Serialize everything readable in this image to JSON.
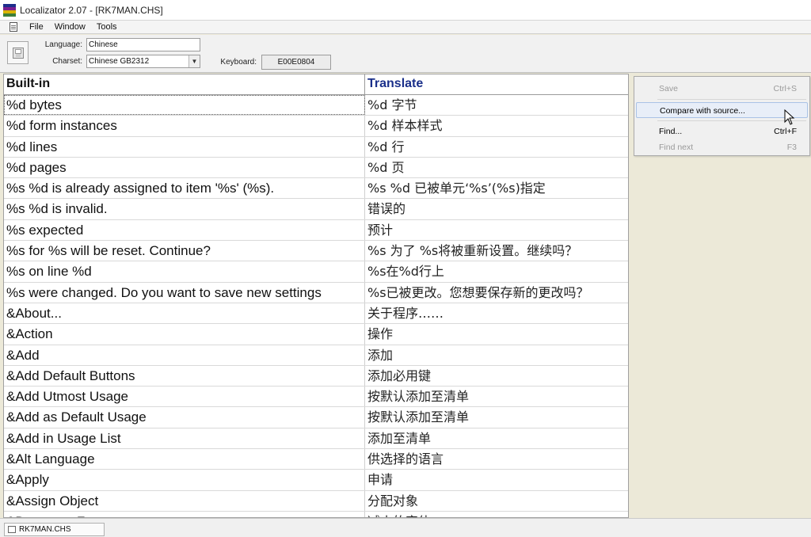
{
  "window": {
    "title": "Localizator 2.07 - [RK7MAN.CHS]"
  },
  "menu": [
    "File",
    "Window",
    "Tools"
  ],
  "toolbar": {
    "language_label": "Language:",
    "language_value": "Chinese",
    "charset_label": "Charset:",
    "charset_value": "Chinese GB2312",
    "keyboard_label": "Keyboard:",
    "keyboard_value": "E00E0804"
  },
  "grid": {
    "columns": [
      "Built-in",
      "Translate"
    ],
    "rows": [
      [
        "%d bytes",
        "%d 字节"
      ],
      [
        "%d form instances",
        "%d 样本样式"
      ],
      [
        "%d lines",
        "%d 行"
      ],
      [
        "%d pages",
        "%d 页"
      ],
      [
        "%s %d is already assigned to item '%s' (%s).",
        "%s %d 已被单元‘%s’(%s)指定"
      ],
      [
        "%s %d is invalid.",
        "错误的"
      ],
      [
        "%s expected",
        "预计"
      ],
      [
        "%s for %s will be reset. Continue?",
        "%s 为了 %s将被重新设置。继续吗？"
      ],
      [
        "%s on line %d",
        "%s在%d行上"
      ],
      [
        "%s were changed. Do you want to save new settings",
        "%s已被更改。您想要保存新的更改吗？"
      ],
      [
        "&About...",
        "关于程序……"
      ],
      [
        "&Action",
        "操作"
      ],
      [
        "&Add",
        "添加"
      ],
      [
        "&Add Default Buttons",
        "添加必用键"
      ],
      [
        "&Add Utmost Usage",
        "按默认添加至清单"
      ],
      [
        "&Add as Default Usage",
        "按默认添加至清单"
      ],
      [
        "&Add in Usage List",
        "添加至清单"
      ],
      [
        "&Alt Language",
        "供选择的语言"
      ],
      [
        "&Apply",
        "申请"
      ],
      [
        "&Assign Object",
        "分配对象"
      ],
      [
        "&Decrease Font",
        "减小的字体"
      ]
    ]
  },
  "context_menu": {
    "items": [
      {
        "label": "Save",
        "shortcut": "Ctrl+S",
        "disabled": true
      },
      {
        "label": "Compare with source...",
        "shortcut": "",
        "disabled": false,
        "hover": true
      },
      {
        "label": "Find...",
        "shortcut": "Ctrl+F",
        "disabled": false
      },
      {
        "label": "Find next",
        "shortcut": "F3",
        "disabled": true
      }
    ]
  },
  "status": {
    "tab": "RK7MAN.CHS"
  }
}
